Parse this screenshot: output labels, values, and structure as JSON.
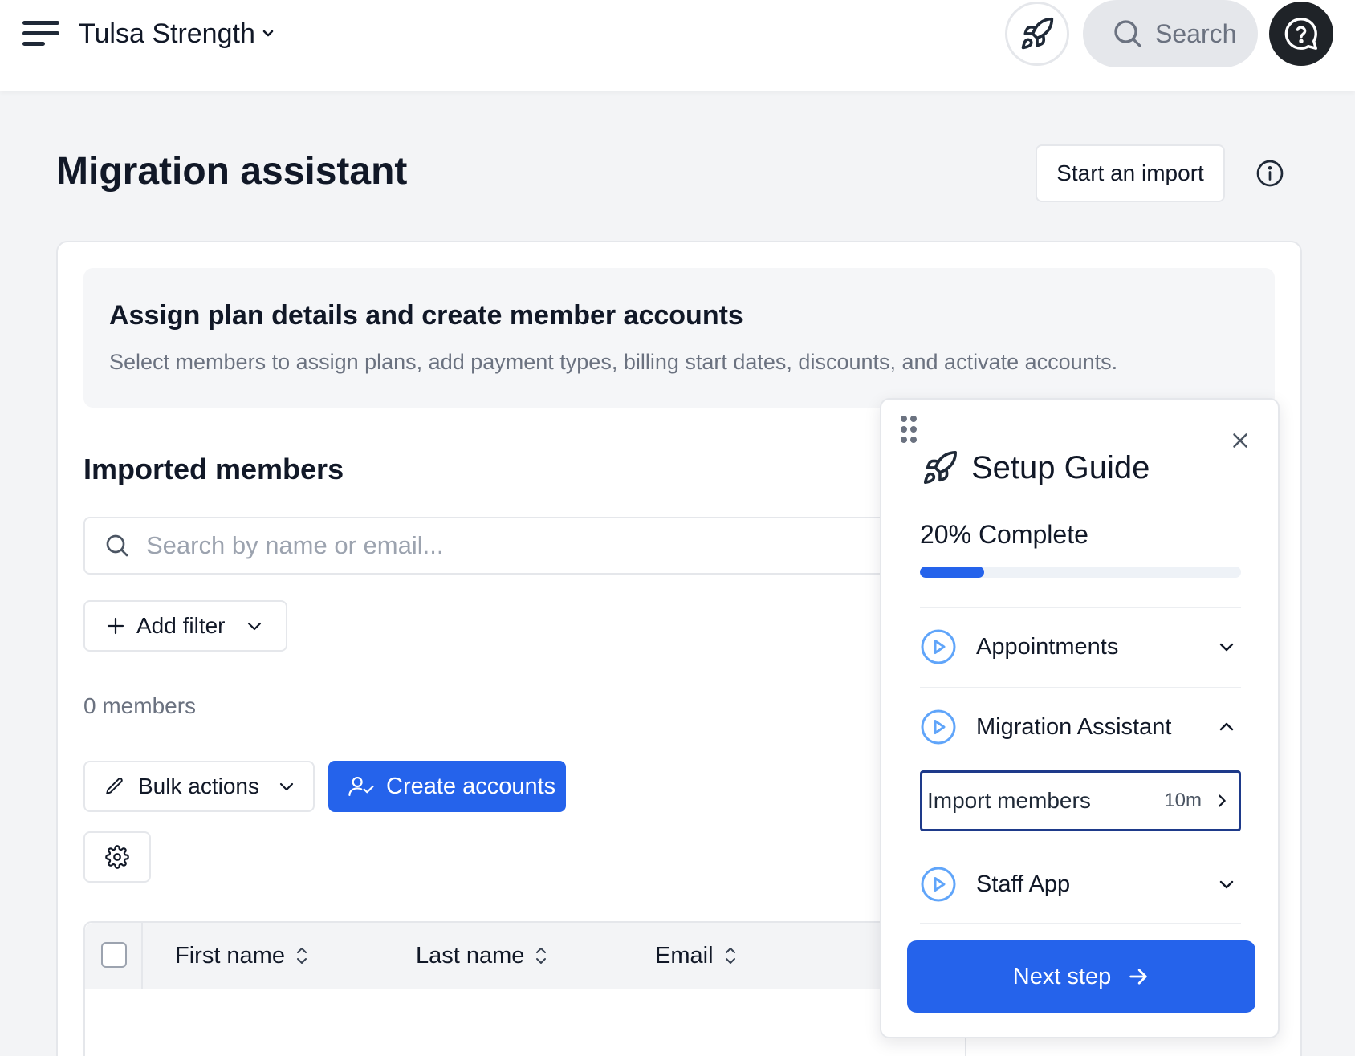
{
  "header": {
    "org_name": "Tulsa Strength",
    "search_label": "Search"
  },
  "page": {
    "title": "Migration assistant",
    "start_import_label": "Start an import"
  },
  "banner": {
    "title": "Assign plan details and create member accounts",
    "subtitle": "Select members to assign plans, add payment types, billing start dates, discounts, and activate accounts."
  },
  "members": {
    "section_title": "Imported members",
    "search_placeholder": "Search by name or email...",
    "search_value": "",
    "add_filter_label": "Add filter",
    "count_label": "0 members",
    "bulk_actions_label": "Bulk actions",
    "create_accounts_label": "Create accounts",
    "table": {
      "columns": [
        "First name",
        "Last name",
        "Email"
      ],
      "rows": []
    }
  },
  "setup_guide": {
    "title": "Setup Guide",
    "progress_label": "20% Complete",
    "progress_fraction": 0.2,
    "items": [
      {
        "label": "Appointments",
        "expanded": false
      },
      {
        "label": "Migration Assistant",
        "expanded": true
      },
      {
        "label": "Staff App",
        "expanded": false
      }
    ],
    "active_task": {
      "label": "Import members",
      "duration": "10m"
    },
    "next_step_label": "Next step"
  },
  "colors": {
    "accent": "#2563eb",
    "active_task_border": "#1e3a8a",
    "play_icon": "#60a5fa",
    "page_background": "#f3f4f6"
  },
  "icons": [
    "menu-icon",
    "chevron-down-icon",
    "rocket-icon",
    "search-icon",
    "help-chat-icon",
    "info-icon",
    "plus-icon",
    "pencil-icon",
    "user-check-icon",
    "gear-icon",
    "sort-icon",
    "drag-handle-icon",
    "close-icon",
    "play-circle-icon",
    "chevron-up-icon",
    "chevron-right-icon",
    "arrow-right-icon"
  ]
}
